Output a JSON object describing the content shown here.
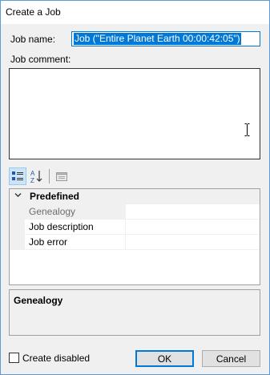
{
  "window": {
    "title": "Create a Job"
  },
  "form": {
    "job_name_label": "Job name:",
    "job_name_value": "Job (\"Entire Planet Earth 00:00:42:05\")",
    "job_comment_label": "Job comment:",
    "job_comment_value": ""
  },
  "toolbar": {
    "buttons": [
      {
        "icon": "categorized-view-icon",
        "active": true
      },
      {
        "icon": "sort-alphabetical-icon",
        "active": false
      },
      {
        "icon": "property-pages-icon",
        "active": false
      }
    ]
  },
  "property_grid": {
    "category": "Predefined",
    "rows": [
      {
        "name": "Genealogy",
        "value": "",
        "selected": true
      },
      {
        "name": "Job description",
        "value": "",
        "selected": false
      },
      {
        "name": "Job error",
        "value": "",
        "selected": false
      }
    ]
  },
  "description_pane": {
    "title": "Genealogy"
  },
  "footer": {
    "create_disabled_label": "Create disabled",
    "create_disabled_checked": false,
    "ok_label": "OK",
    "cancel_label": "Cancel"
  }
}
